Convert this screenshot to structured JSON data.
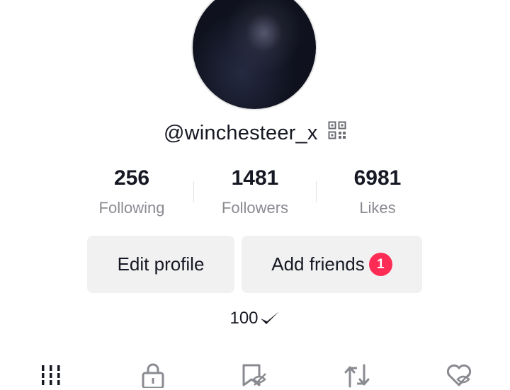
{
  "profile": {
    "username": "@winchesteer_x",
    "bio": "100"
  },
  "stats": [
    {
      "value": "256",
      "label": "Following"
    },
    {
      "value": "1481",
      "label": "Followers"
    },
    {
      "value": "6981",
      "label": "Likes"
    }
  ],
  "actions": {
    "edit_profile": "Edit profile",
    "add_friends": "Add friends",
    "add_friends_badge": "1"
  },
  "tabs": [
    {
      "icon": "videos-grid-icon"
    },
    {
      "icon": "lock-icon"
    },
    {
      "icon": "saved-hidden-icon"
    },
    {
      "icon": "repost-icon"
    },
    {
      "icon": "liked-hidden-icon"
    }
  ],
  "colors": {
    "badge": "#fe2c55",
    "button_bg": "#f1f1f2",
    "secondary_text": "#8a8b91"
  }
}
